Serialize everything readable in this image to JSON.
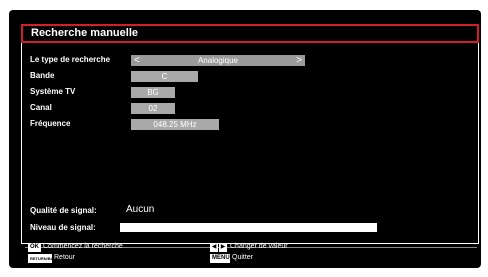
{
  "title": "Recherche manuelle",
  "fields": {
    "search_type": {
      "label": "Le type de recherche",
      "value": "Analogique",
      "left_arrow": "<",
      "right_arrow": ">"
    },
    "band": {
      "label": "Bande",
      "value": "C"
    },
    "tv_system": {
      "label": "Système TV",
      "value": "BG"
    },
    "channel": {
      "label": "Canal",
      "value": "02"
    },
    "frequency": {
      "label": "Fréquence",
      "value": "048.25 MHz"
    }
  },
  "signal": {
    "quality_label": "Qualité de signal:",
    "quality_value": "Aucun",
    "level_label": "Niveau de signal:"
  },
  "footer": {
    "ok_key": "OK",
    "ok_hint": "Commencez la recherche",
    "back_key": "RETURN/BACK",
    "back_hint": "Retour",
    "arrow_left": "◀",
    "arrow_right": "▶",
    "change_hint": "Changer de valeur",
    "menu_key": "MENU",
    "menu_hint": "Quitter"
  },
  "colors": {
    "accent": "#d21f2a",
    "field_bg": "#a9a9a9",
    "background": "#000000"
  }
}
